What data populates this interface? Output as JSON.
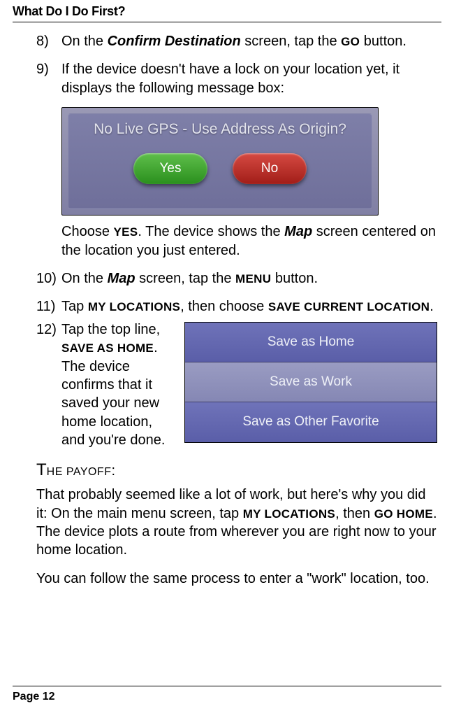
{
  "header": {
    "title": "What Do I Do First?"
  },
  "steps": {
    "s8": {
      "num": "8)",
      "pre": "On the ",
      "screen": "Confirm Destination",
      "mid": " screen, tap the ",
      "btn": "GO",
      "post": " button."
    },
    "s9": {
      "num": "9)",
      "text": "If the device doesn't have a lock on your location yet, it displays the following message box:"
    },
    "dialog1": {
      "title": "No Live GPS - Use Address As Origin?",
      "yes": "Yes",
      "no": "No"
    },
    "after9": {
      "pre": "Choose ",
      "yesbtn": "YES",
      "mid1": ". The device shows the ",
      "map": "Map",
      "post": " screen centered on the location you just entered."
    },
    "s10": {
      "num": "10)",
      "pre": "On the ",
      "map": "Map",
      "mid": " screen, tap the ",
      "btn": "MENU",
      "post": " button."
    },
    "s11": {
      "num": "11)",
      "pre": "Tap ",
      "btn1": "MY LOCATIONS",
      "mid": ", then choose ",
      "btn2": "SAVE CURRENT LOCATION",
      "post": "."
    },
    "s12": {
      "num": "12)",
      "pre": "Tap the top line, ",
      "btn": "SAVE AS HOME",
      "post": ". The device confirms that it saved your new home location, and you're done."
    },
    "savelist": {
      "row1": "Save as Home",
      "row2": "Save as Work",
      "row3": "Save as Other Favorite"
    }
  },
  "payoff": {
    "head_first": "T",
    "head_rest": "HE PAYOFF",
    "colon": ":",
    "p1_pre": "That probably seemed like a lot of work, but here's why you did it: On the main menu screen, tap ",
    "p1_b1": "MY LOCATIONS",
    "p1_mid": ", then ",
    "p1_b2": "GO HOME",
    "p1_post": ". The device plots a route from wherever you are right now to your home location.",
    "p2": "You can follow the same process to enter a \"work\" location, too."
  },
  "footer": {
    "page": "Page 12"
  }
}
